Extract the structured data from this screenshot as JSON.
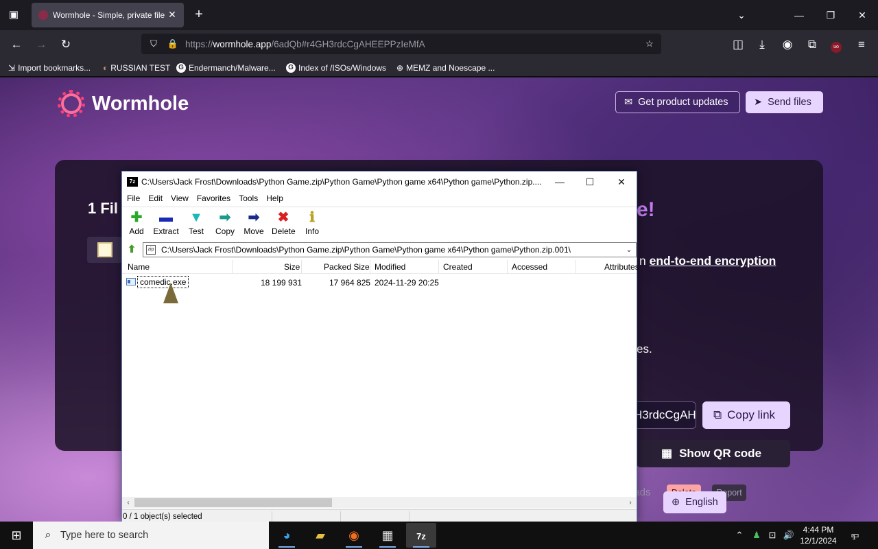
{
  "browser": {
    "tab_title": "Wormhole - Simple, private file",
    "url_prefix": "https://",
    "url_host": "wormhole.app",
    "url_path": "/6adQb#r4GH3rdcCgAHEEPPzIeMfA",
    "bookmarks": [
      {
        "label": "Import bookmarks..."
      },
      {
        "label": "RUSSIAN TEST"
      },
      {
        "label": "Endermanch/Malware..."
      },
      {
        "label": "Index of /ISOs/Windows"
      },
      {
        "label": "MEMZ and Noescape ..."
      }
    ]
  },
  "site": {
    "brand": "Wormhole",
    "get_updates": "Get product updates",
    "send_files": "Send files",
    "card_title_start": "1 Fil",
    "card_title_end": "e!",
    "encryption_prefix": "n",
    "encryption_link": "end-to-end encryption",
    "encryption_line2": "es.",
    "link_box_value": "H3rdcCgAH",
    "copy_link": "Copy link",
    "show_qr": "Show QR code",
    "downloads_text": "oads",
    "delete": "Delete",
    "report": "Report",
    "language": "English"
  },
  "sevenzip": {
    "title": "C:\\Users\\Jack Frost\\Downloads\\Python Game.zip\\Python Game\\Python game x64\\Python game\\Python.zip....",
    "icon_text": "7z",
    "menu": [
      "File",
      "Edit",
      "View",
      "Favorites",
      "Tools",
      "Help"
    ],
    "toolbar": [
      {
        "label": "Add",
        "glyph": "✚",
        "color": "#2aa82a"
      },
      {
        "label": "Extract",
        "glyph": "▬",
        "color": "#1a2ab8"
      },
      {
        "label": "Test",
        "glyph": "▼",
        "color": "#1ab8b8"
      },
      {
        "label": "Copy",
        "glyph": "➡",
        "color": "#1a9a8a"
      },
      {
        "label": "Move",
        "glyph": "➡",
        "color": "#1a2a8a"
      },
      {
        "label": "Delete",
        "glyph": "✖",
        "color": "#d82020"
      },
      {
        "label": "Info",
        "glyph": "ℹ",
        "color": "#b8a020"
      }
    ],
    "path": "C:\\Users\\Jack Frost\\Downloads\\Python Game.zip\\Python Game\\Python game x64\\Python game\\Python.zip.001\\",
    "columns": [
      "Name",
      "Size",
      "Packed Size",
      "Modified",
      "Created",
      "Accessed",
      "Attributes"
    ],
    "rows": [
      {
        "name": "comedic.exe",
        "size": "18 199 931",
        "packed": "17 964 825",
        "modified": "2024-11-29 20:25"
      }
    ],
    "status": "0 / 1 object(s) selected"
  },
  "taskbar": {
    "search_placeholder": "Type here to search",
    "time": "4:44 PM",
    "date": "12/1/2024",
    "notification_count": "1"
  }
}
